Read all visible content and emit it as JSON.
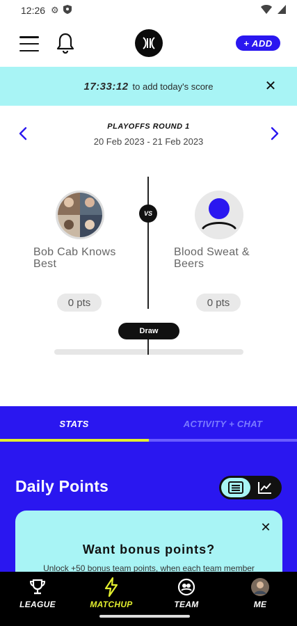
{
  "status_bar": {
    "time": "12:26"
  },
  "header": {
    "add_label": "+ ADD"
  },
  "banner": {
    "timer": "17:33:12",
    "message": "to add today's score"
  },
  "round": {
    "title": "PLAYOFFS ROUND 1",
    "dates": "20 Feb 2023 - 21 Feb 2023"
  },
  "matchup": {
    "vs_label": "VS",
    "left_team": {
      "name": "Bob Cab Knows Best",
      "points": "0 pts"
    },
    "right_team": {
      "name": "Blood Sweat & Beers",
      "points": "0 pts"
    },
    "result_label": "Draw"
  },
  "tabs": {
    "stats": "STATS",
    "activity": "ACTIVITY + CHAT",
    "active": "STATS"
  },
  "daily_points": {
    "title": "Daily Points",
    "view_mode": "list"
  },
  "bonus_card": {
    "title": "Want bonus points?",
    "subtitle": "Unlock +50 bonus team points, when each team member"
  },
  "bottom_nav": {
    "items": [
      {
        "label": "LEAGUE",
        "icon": "trophy-icon"
      },
      {
        "label": "MATCHUP",
        "icon": "lightning-icon"
      },
      {
        "label": "TEAM",
        "icon": "team-icon"
      },
      {
        "label": "ME",
        "icon": "profile-avatar"
      }
    ],
    "active": "MATCHUP"
  },
  "colors": {
    "primary": "#2a17f0",
    "accent_cyan": "#a8f4f5",
    "accent_yellow": "#e3ef2f"
  }
}
